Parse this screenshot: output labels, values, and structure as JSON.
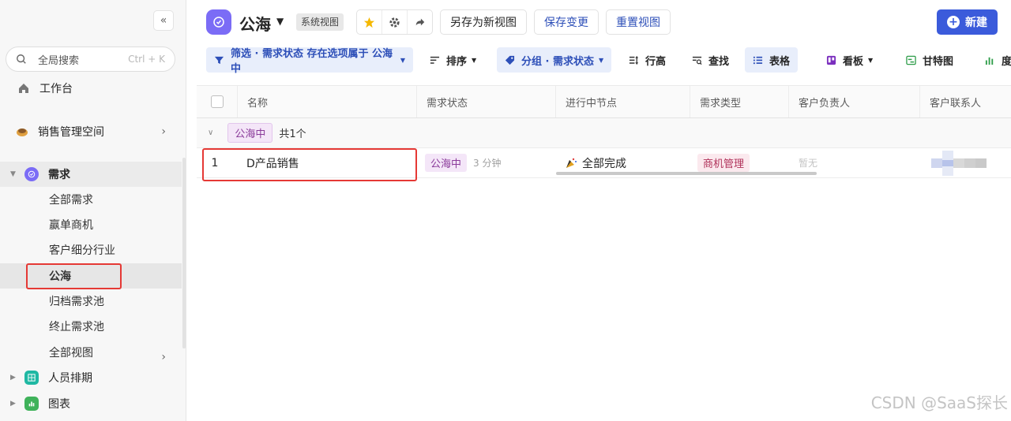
{
  "sidebar": {
    "search_placeholder": "全局搜索",
    "search_shortcut": "Ctrl + K",
    "workbench": "工作台",
    "space": "销售管理空间",
    "group_label": "需求",
    "items": [
      {
        "label": "全部需求"
      },
      {
        "label": "赢单商机"
      },
      {
        "label": "客户细分行业"
      },
      {
        "label": "公海"
      },
      {
        "label": "归档需求池"
      },
      {
        "label": "终止需求池"
      },
      {
        "label": "全部视图"
      }
    ],
    "extra_groups": [
      {
        "label": "人员排期",
        "color": "#1fb8a3"
      },
      {
        "label": "图表",
        "color": "#3fb25a"
      }
    ]
  },
  "header": {
    "title": "公海",
    "system_tag": "系统视图",
    "save_as": "另存为新视图",
    "save_changes": "保存变更",
    "reset_view": "重置视图",
    "new_button": "新建"
  },
  "toolbar": {
    "filter": "筛选 · 需求状态 存在选项属于 公海中",
    "sort": "排序",
    "group": "分组 · 需求状态",
    "row_height": "行高",
    "find": "查找",
    "table": "表格",
    "kanban": "看板",
    "gantt": "甘特图",
    "more": "度"
  },
  "table": {
    "columns": [
      "名称",
      "需求状态",
      "进行中节点",
      "需求类型",
      "客户负责人",
      "客户联系人"
    ],
    "group": {
      "label": "公海中",
      "count": "共1个"
    },
    "rows": [
      {
        "index": "1",
        "name": "D产品销售",
        "status": "公海中",
        "time": "3 分钟",
        "node": "全部完成",
        "type": "商机管理",
        "owner": "暂无"
      }
    ]
  },
  "watermark": "CSDN @SaaS探长",
  "colors": {
    "accent": "#3b5bdb",
    "purple": "#7b6cf6",
    "highlight": "#e53935"
  }
}
